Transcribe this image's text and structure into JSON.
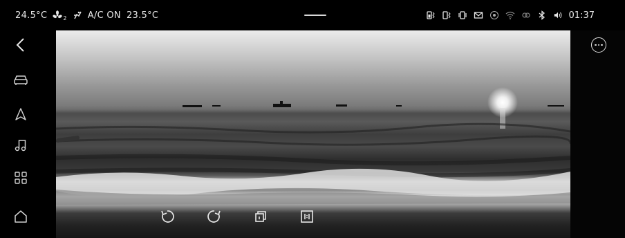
{
  "status_bar": {
    "cabin_temp": "24.5°C",
    "fan_level": "2",
    "ac_status": "A/C ON",
    "ac_temp": "23.5°C",
    "time": "01:37",
    "icons": [
      "battery-bluetooth-icon",
      "phone-bluetooth-icon",
      "vibrate-icon",
      "mail-icon",
      "hotspot-icon",
      "wifi-icon",
      "link-icon",
      "bluetooth-icon",
      "volume-icon"
    ]
  },
  "sidebar": {
    "items": [
      "back-icon",
      "car-icon",
      "navigation-icon",
      "music-icon",
      "apps-icon",
      "home-icon"
    ]
  },
  "viewer": {
    "image_alt": "Black and white photo of the sea with ships on the horizon and waves breaking on the shore",
    "toolbar": [
      "rotate-left",
      "rotate-right",
      "crop",
      "original-size"
    ]
  }
}
